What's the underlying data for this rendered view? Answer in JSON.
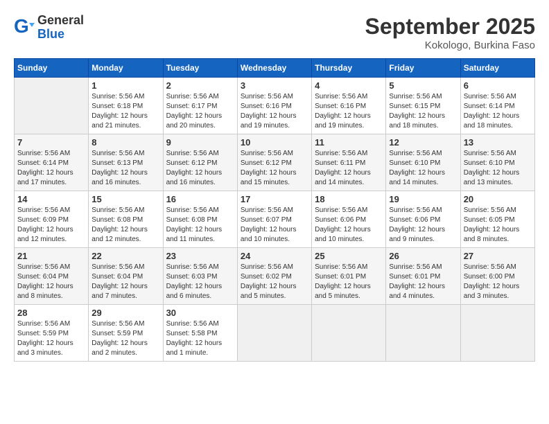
{
  "header": {
    "logo_line1": "General",
    "logo_line2": "Blue",
    "month": "September 2025",
    "location": "Kokologo, Burkina Faso"
  },
  "weekdays": [
    "Sunday",
    "Monday",
    "Tuesday",
    "Wednesday",
    "Thursday",
    "Friday",
    "Saturday"
  ],
  "weeks": [
    [
      {
        "day": "",
        "info": ""
      },
      {
        "day": "1",
        "info": "Sunrise: 5:56 AM\nSunset: 6:18 PM\nDaylight: 12 hours\nand 21 minutes."
      },
      {
        "day": "2",
        "info": "Sunrise: 5:56 AM\nSunset: 6:17 PM\nDaylight: 12 hours\nand 20 minutes."
      },
      {
        "day": "3",
        "info": "Sunrise: 5:56 AM\nSunset: 6:16 PM\nDaylight: 12 hours\nand 19 minutes."
      },
      {
        "day": "4",
        "info": "Sunrise: 5:56 AM\nSunset: 6:16 PM\nDaylight: 12 hours\nand 19 minutes."
      },
      {
        "day": "5",
        "info": "Sunrise: 5:56 AM\nSunset: 6:15 PM\nDaylight: 12 hours\nand 18 minutes."
      },
      {
        "day": "6",
        "info": "Sunrise: 5:56 AM\nSunset: 6:14 PM\nDaylight: 12 hours\nand 18 minutes."
      }
    ],
    [
      {
        "day": "7",
        "info": "Sunrise: 5:56 AM\nSunset: 6:14 PM\nDaylight: 12 hours\nand 17 minutes."
      },
      {
        "day": "8",
        "info": "Sunrise: 5:56 AM\nSunset: 6:13 PM\nDaylight: 12 hours\nand 16 minutes."
      },
      {
        "day": "9",
        "info": "Sunrise: 5:56 AM\nSunset: 6:12 PM\nDaylight: 12 hours\nand 16 minutes."
      },
      {
        "day": "10",
        "info": "Sunrise: 5:56 AM\nSunset: 6:12 PM\nDaylight: 12 hours\nand 15 minutes."
      },
      {
        "day": "11",
        "info": "Sunrise: 5:56 AM\nSunset: 6:11 PM\nDaylight: 12 hours\nand 14 minutes."
      },
      {
        "day": "12",
        "info": "Sunrise: 5:56 AM\nSunset: 6:10 PM\nDaylight: 12 hours\nand 14 minutes."
      },
      {
        "day": "13",
        "info": "Sunrise: 5:56 AM\nSunset: 6:10 PM\nDaylight: 12 hours\nand 13 minutes."
      }
    ],
    [
      {
        "day": "14",
        "info": "Sunrise: 5:56 AM\nSunset: 6:09 PM\nDaylight: 12 hours\nand 12 minutes."
      },
      {
        "day": "15",
        "info": "Sunrise: 5:56 AM\nSunset: 6:08 PM\nDaylight: 12 hours\nand 12 minutes."
      },
      {
        "day": "16",
        "info": "Sunrise: 5:56 AM\nSunset: 6:08 PM\nDaylight: 12 hours\nand 11 minutes."
      },
      {
        "day": "17",
        "info": "Sunrise: 5:56 AM\nSunset: 6:07 PM\nDaylight: 12 hours\nand 10 minutes."
      },
      {
        "day": "18",
        "info": "Sunrise: 5:56 AM\nSunset: 6:06 PM\nDaylight: 12 hours\nand 10 minutes."
      },
      {
        "day": "19",
        "info": "Sunrise: 5:56 AM\nSunset: 6:06 PM\nDaylight: 12 hours\nand 9 minutes."
      },
      {
        "day": "20",
        "info": "Sunrise: 5:56 AM\nSunset: 6:05 PM\nDaylight: 12 hours\nand 8 minutes."
      }
    ],
    [
      {
        "day": "21",
        "info": "Sunrise: 5:56 AM\nSunset: 6:04 PM\nDaylight: 12 hours\nand 8 minutes."
      },
      {
        "day": "22",
        "info": "Sunrise: 5:56 AM\nSunset: 6:04 PM\nDaylight: 12 hours\nand 7 minutes."
      },
      {
        "day": "23",
        "info": "Sunrise: 5:56 AM\nSunset: 6:03 PM\nDaylight: 12 hours\nand 6 minutes."
      },
      {
        "day": "24",
        "info": "Sunrise: 5:56 AM\nSunset: 6:02 PM\nDaylight: 12 hours\nand 5 minutes."
      },
      {
        "day": "25",
        "info": "Sunrise: 5:56 AM\nSunset: 6:01 PM\nDaylight: 12 hours\nand 5 minutes."
      },
      {
        "day": "26",
        "info": "Sunrise: 5:56 AM\nSunset: 6:01 PM\nDaylight: 12 hours\nand 4 minutes."
      },
      {
        "day": "27",
        "info": "Sunrise: 5:56 AM\nSunset: 6:00 PM\nDaylight: 12 hours\nand 3 minutes."
      }
    ],
    [
      {
        "day": "28",
        "info": "Sunrise: 5:56 AM\nSunset: 5:59 PM\nDaylight: 12 hours\nand 3 minutes."
      },
      {
        "day": "29",
        "info": "Sunrise: 5:56 AM\nSunset: 5:59 PM\nDaylight: 12 hours\nand 2 minutes."
      },
      {
        "day": "30",
        "info": "Sunrise: 5:56 AM\nSunset: 5:58 PM\nDaylight: 12 hours\nand 1 minute."
      },
      {
        "day": "",
        "info": ""
      },
      {
        "day": "",
        "info": ""
      },
      {
        "day": "",
        "info": ""
      },
      {
        "day": "",
        "info": ""
      }
    ]
  ]
}
